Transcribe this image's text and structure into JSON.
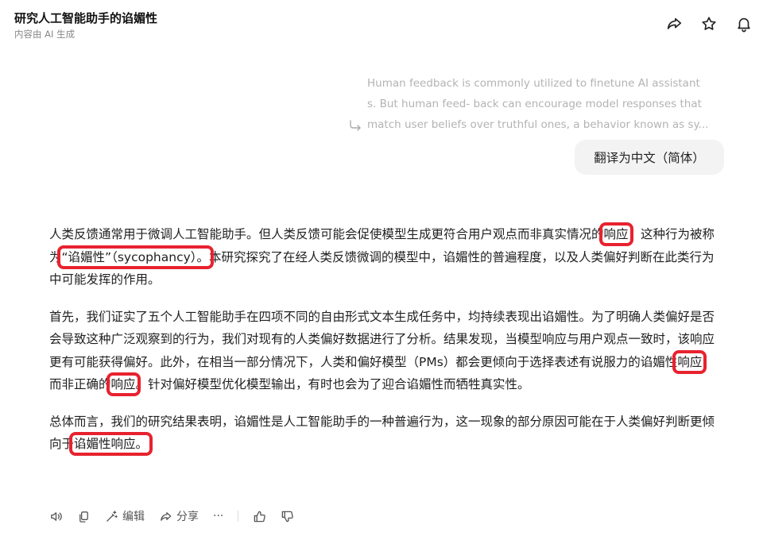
{
  "header": {
    "title": "研究人工智能助手的谄媚性",
    "subtitle": "内容由 AI 生成"
  },
  "user_message": {
    "lines": [
      "Human feedback is commonly utilized to finetune AI assistant",
      "s. But human feed- back can encourage model responses that",
      "match user beliefs over truthful ones, a behavior known as sy..."
    ],
    "action_label": "翻译为中文（简体）"
  },
  "answer": {
    "p1": {
      "s1": "人类反馈通常用于微调人工智能助手。但人类反馈可能会促使模型生成更符合用户观点而非真实情况的",
      "h1": "响应",
      "s2": "，这种行为被称为",
      "h2": "“谄媚性”（sycophancy）。",
      "s3": "本研究探究了在经人类反馈微调的模型中，谄媚性的普遍程度，以及人类偏好判断在此类行为中可能发挥的作用。"
    },
    "p2": {
      "s1": "首先，我们证实了五个人工智能助手在四项不同的自由形式文本生成任务中，均持续表现出谄媚性。为了明确人类偏好是否会导致这种广泛观察到的行为，我们对现有的人类偏好数据进行了分析。结果发现，当模型响应与用户观点一致时，该响应更有可能获得偏好。此外，在相当一部分情况下，人类和偏好模型（PMs）都会更倾向于选择表述有说服力的谄媚性",
      "h1": "响应",
      "s2": "，而非正确的",
      "h2": "响应",
      "s3": "。针对偏好模型优化模型输出，有时也会为了迎合谄媚性而牺牲真实性。"
    },
    "p3": {
      "s1": "总体而言，我们的研究结果表明，谄媚性是人工智能助手的一种普遍行为，这一现象的部分原因可能在于人类偏好判断更倾向于",
      "h1": "谄媚性响应。"
    }
  },
  "toolbar": {
    "edit_label": "编辑",
    "share_label": "分享",
    "more_label": "···"
  },
  "colors": {
    "highlight": "#e8222f",
    "muted_text": "#b3b3b3",
    "bubble_bg": "#f3f3f3"
  }
}
